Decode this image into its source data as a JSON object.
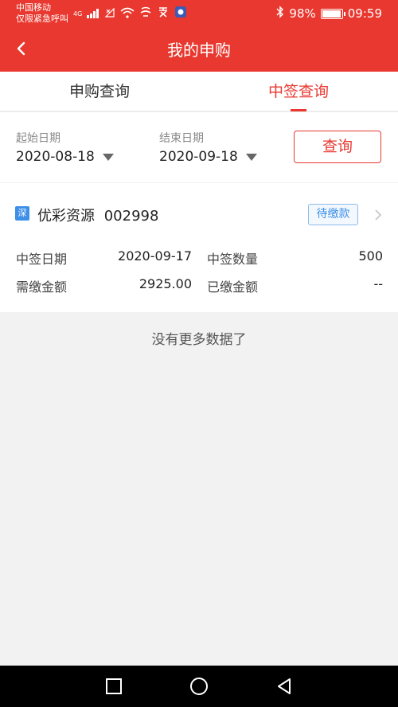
{
  "status_bar": {
    "carrier_line1": "中国移动",
    "carrier_line2": "仅限紧急呼叫",
    "network_tag": "4G",
    "battery": "98%",
    "time": "09:59"
  },
  "header": {
    "title": "我的申购",
    "back_icon": "chevron-left-icon"
  },
  "tabs": [
    {
      "label": "申购查询",
      "active": false
    },
    {
      "label": "中签查询",
      "active": true
    }
  ],
  "filter": {
    "start_label": "起始日期",
    "start_value": "2020-08-18",
    "end_label": "结束日期",
    "end_value": "2020-09-18",
    "query_button": "查询"
  },
  "records": [
    {
      "market_tag": "深",
      "name": "优彩资源",
      "code": "002998",
      "status": "待缴款",
      "win_date_label": "中签日期",
      "win_date": "2020-09-17",
      "win_qty_label": "中签数量",
      "win_qty": "500",
      "due_amount_label": "需缴金额",
      "due_amount": "2925.00",
      "paid_amount_label": "已缴金额",
      "paid_amount": "--"
    }
  ],
  "footer_text": "没有更多数据了",
  "colors": {
    "brand": "#e8382f",
    "badge_blue": "#3d8fe8"
  }
}
